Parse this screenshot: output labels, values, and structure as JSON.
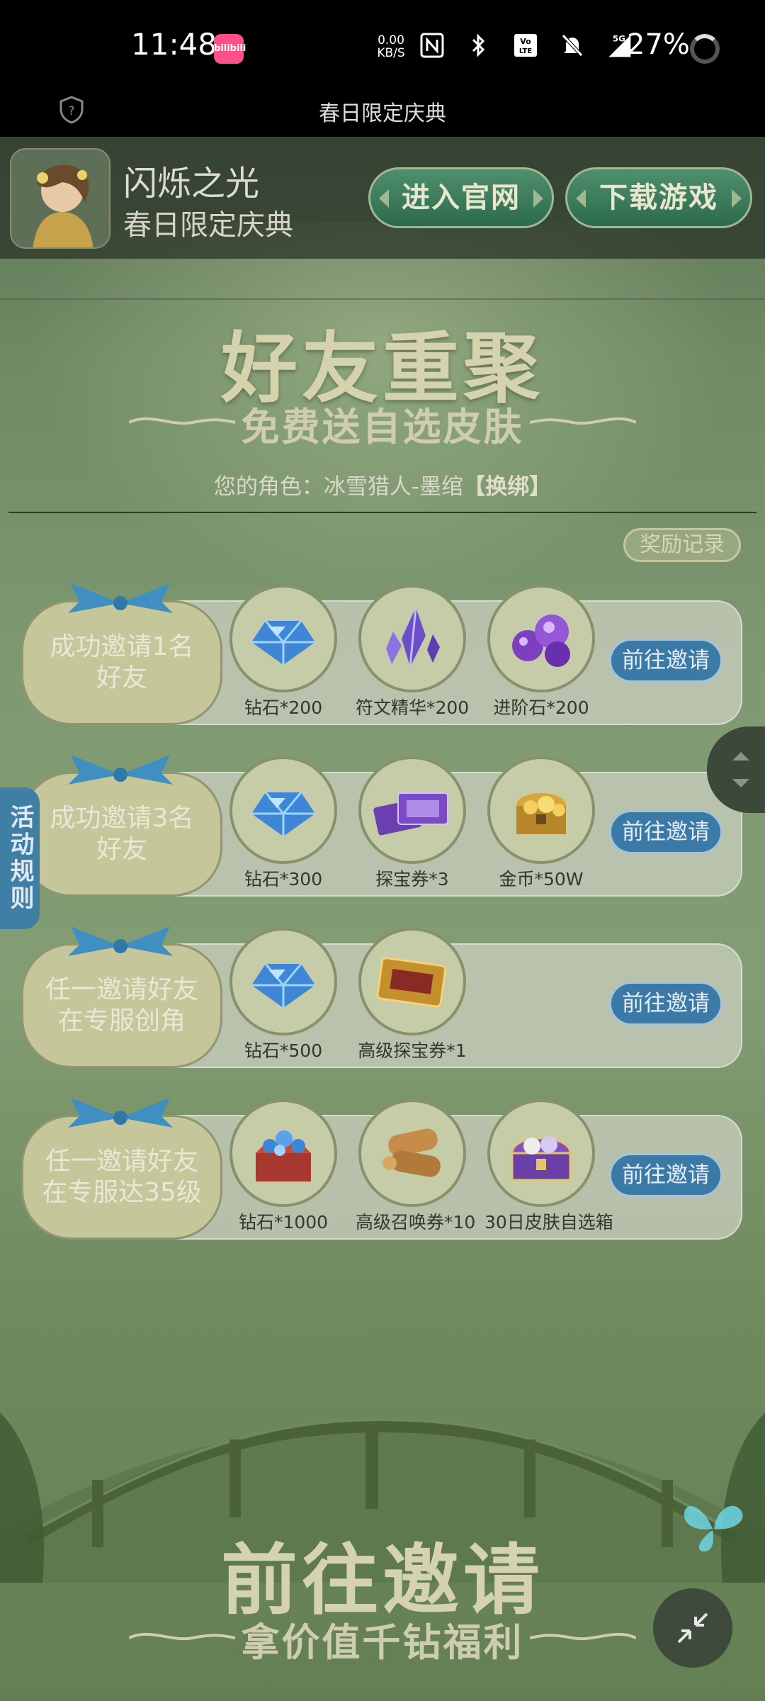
{
  "status_bar": {
    "time": "11:48",
    "app_badge": "bilibili",
    "net_speed_value": "0.00",
    "net_speed_unit": "KB/S",
    "network": "5G",
    "battery": "27%"
  },
  "titlebar": {
    "title": "春日限定庆典"
  },
  "header": {
    "game_name": "闪烁之光",
    "game_sub": "春日限定庆典",
    "official_site_btn": "进入官网",
    "download_btn": "下载游戏"
  },
  "banner": {
    "title": "好友重聚",
    "subtitle": "免费送自选皮肤",
    "role_prefix": "您的角色：冰雪猎人-墨绾",
    "rebind": "【换绑】",
    "record_btn": "奖励记录"
  },
  "side": {
    "rules_tab": "活动规则"
  },
  "tasks": [
    {
      "label": "成功邀请1名好友",
      "button": "前往邀请",
      "rewards": [
        {
          "name": "钻石*200",
          "icon": "diamond-icon"
        },
        {
          "name": "符文精华*200",
          "icon": "rune-crystal-icon"
        },
        {
          "name": "进阶石*200",
          "icon": "advance-stone-icon"
        }
      ]
    },
    {
      "label": "成功邀请3名好友",
      "button": "前往邀请",
      "rewards": [
        {
          "name": "钻石*300",
          "icon": "diamond-icon"
        },
        {
          "name": "探宝券*3",
          "icon": "treasure-ticket-icon"
        },
        {
          "name": "金币*50W",
          "icon": "gold-chest-icon"
        }
      ]
    },
    {
      "label": "任一邀请好友在专服创角",
      "button": "前往邀请",
      "rewards": [
        {
          "name": "钻石*500",
          "icon": "diamond-icon"
        },
        {
          "name": "高级探宝券*1",
          "icon": "premium-treasure-ticket-icon"
        }
      ]
    },
    {
      "label": "任一邀请好友在专服达35级",
      "button": "前往邀请",
      "rewards": [
        {
          "name": "钻石*1000",
          "icon": "diamond-box-icon"
        },
        {
          "name": "高级召唤券*10",
          "icon": "summon-scroll-icon"
        },
        {
          "name": "30日皮肤自选箱",
          "icon": "skin-chest-icon"
        }
      ]
    }
  ],
  "bottom": {
    "title": "前往邀请",
    "subtitle": "拿价值千钻福利"
  },
  "colors": {
    "page_green": "#7f9a72",
    "go_button": "#3b79a6",
    "rules_tab": "#3f7fa6",
    "header_button": "#2d6a4e"
  }
}
